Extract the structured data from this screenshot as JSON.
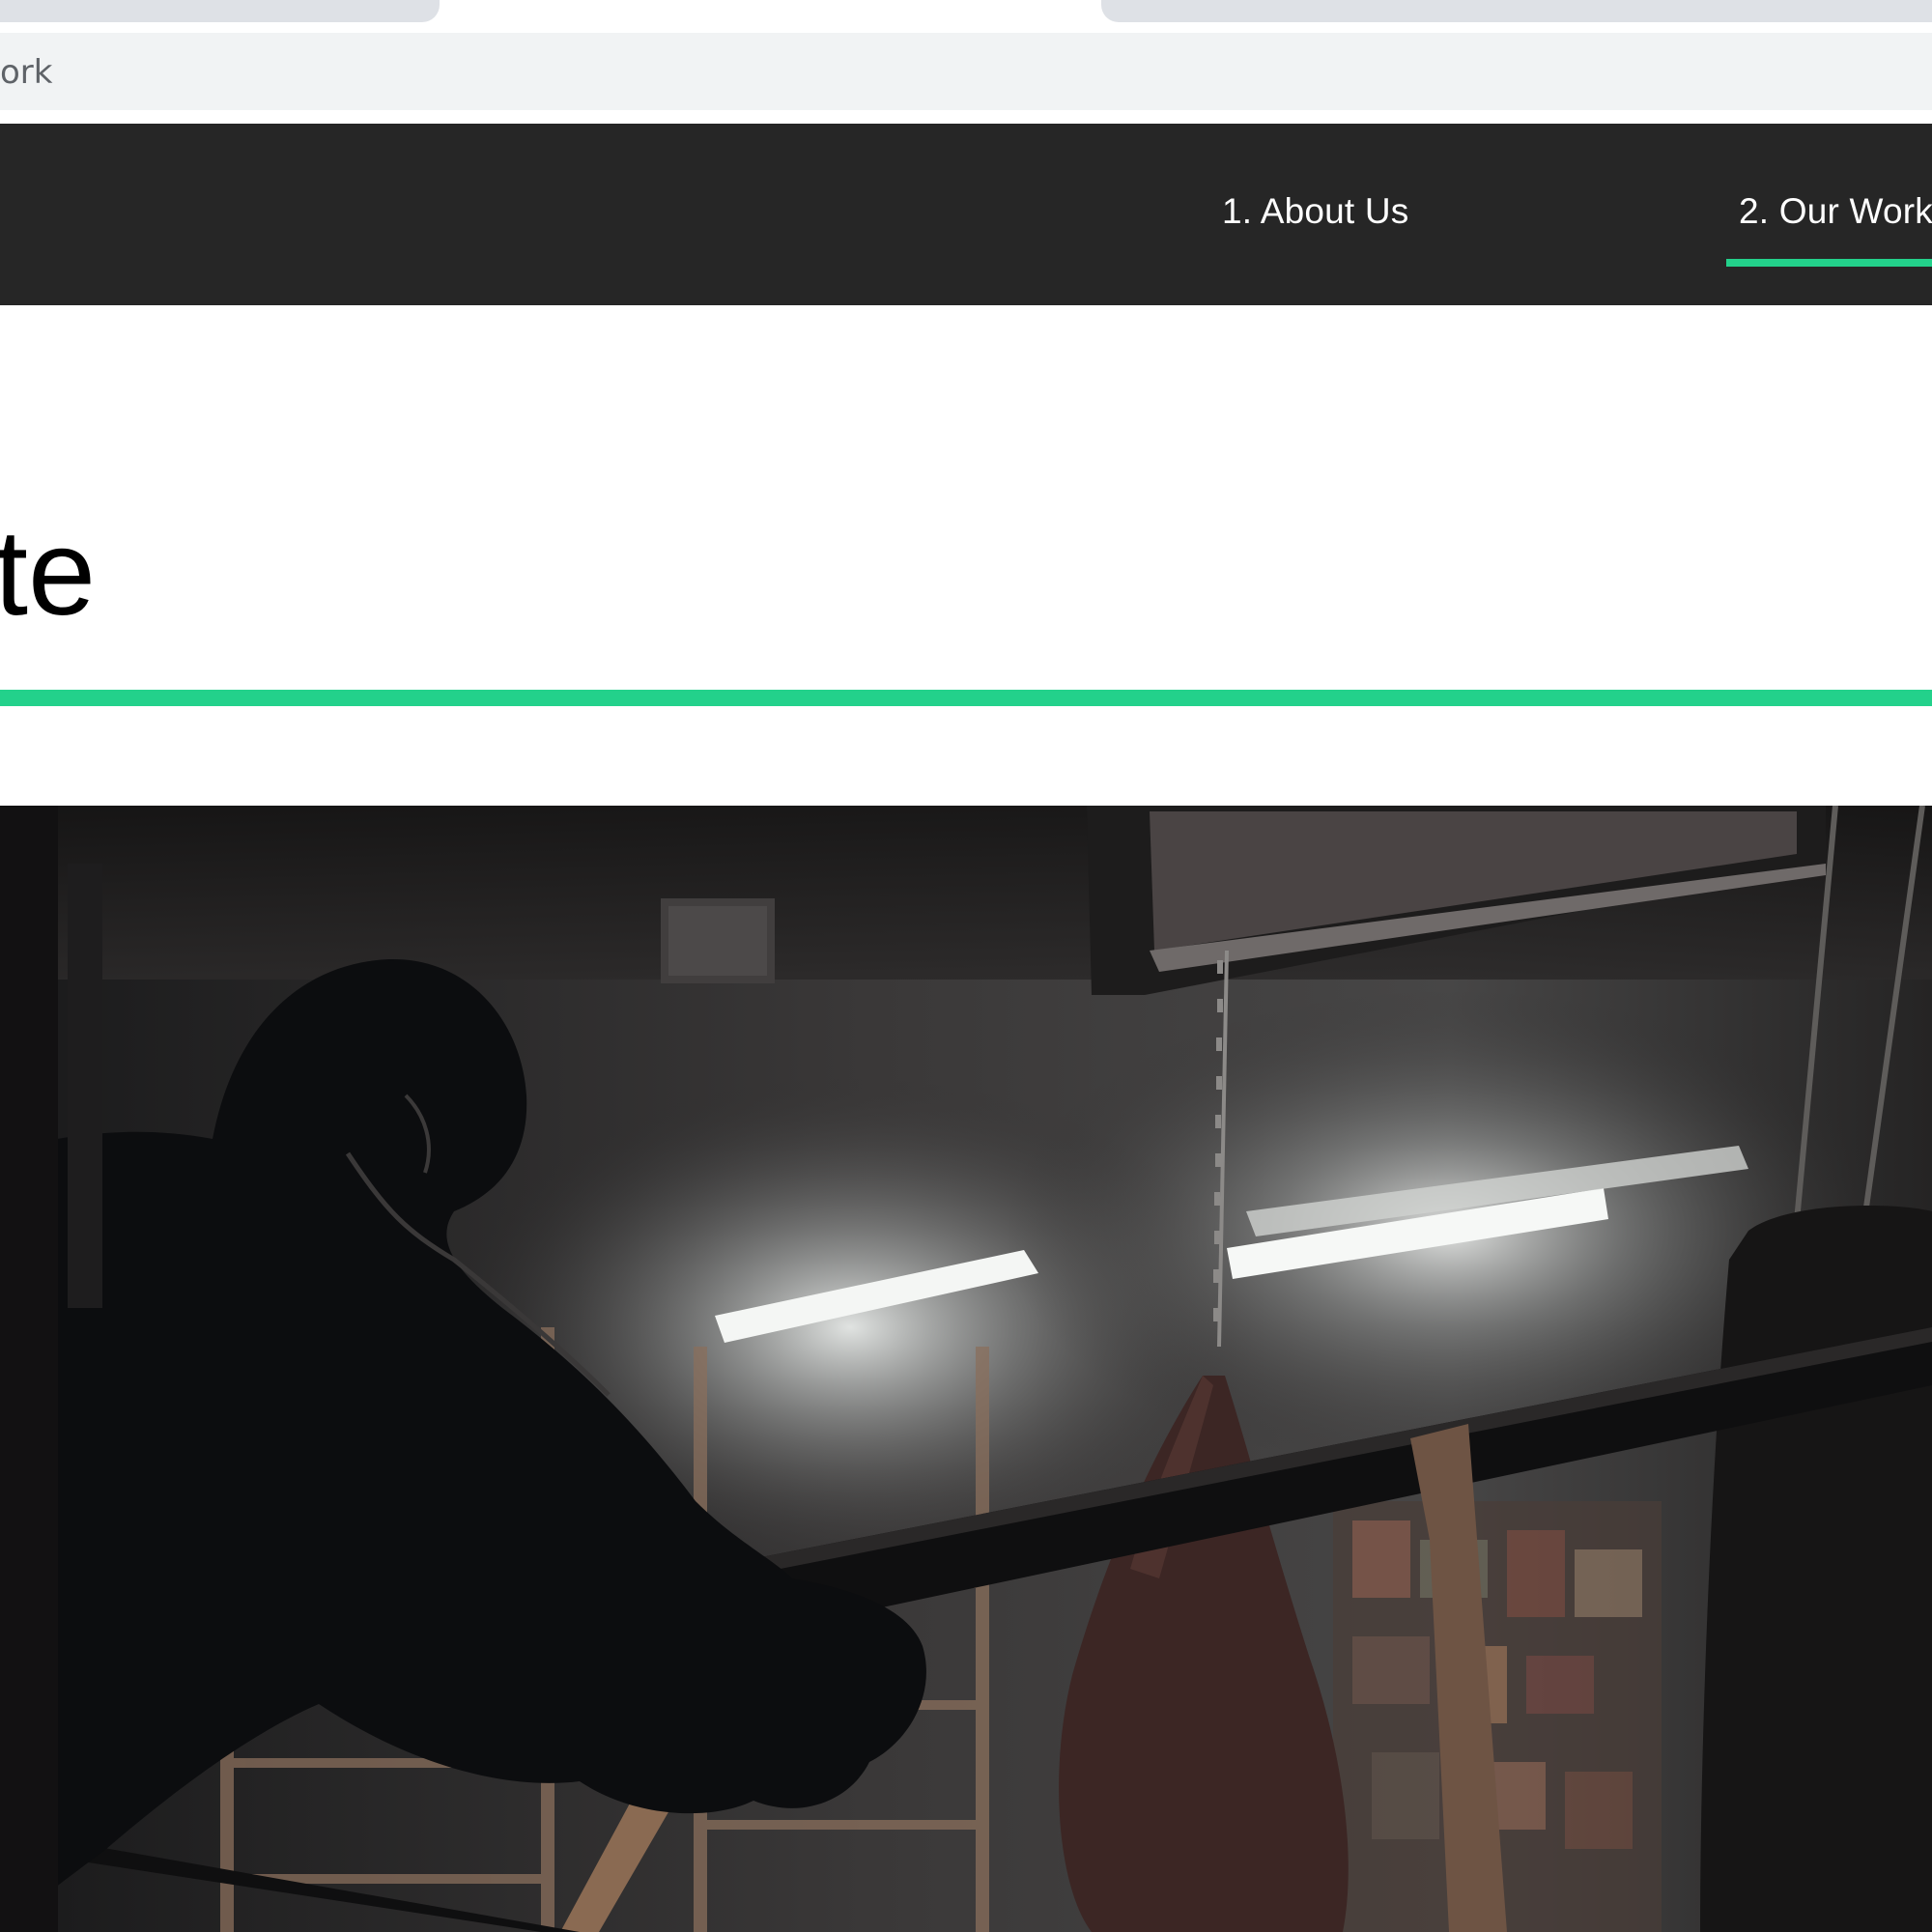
{
  "browser": {
    "url_fragment": "ork"
  },
  "nav": {
    "items": [
      {
        "label": "1. About Us",
        "active": false
      },
      {
        "label": "2. Our Work",
        "active": true
      }
    ],
    "accent_color": "#23d18b",
    "background_color": "#262626"
  },
  "hero": {
    "heading": "te"
  }
}
